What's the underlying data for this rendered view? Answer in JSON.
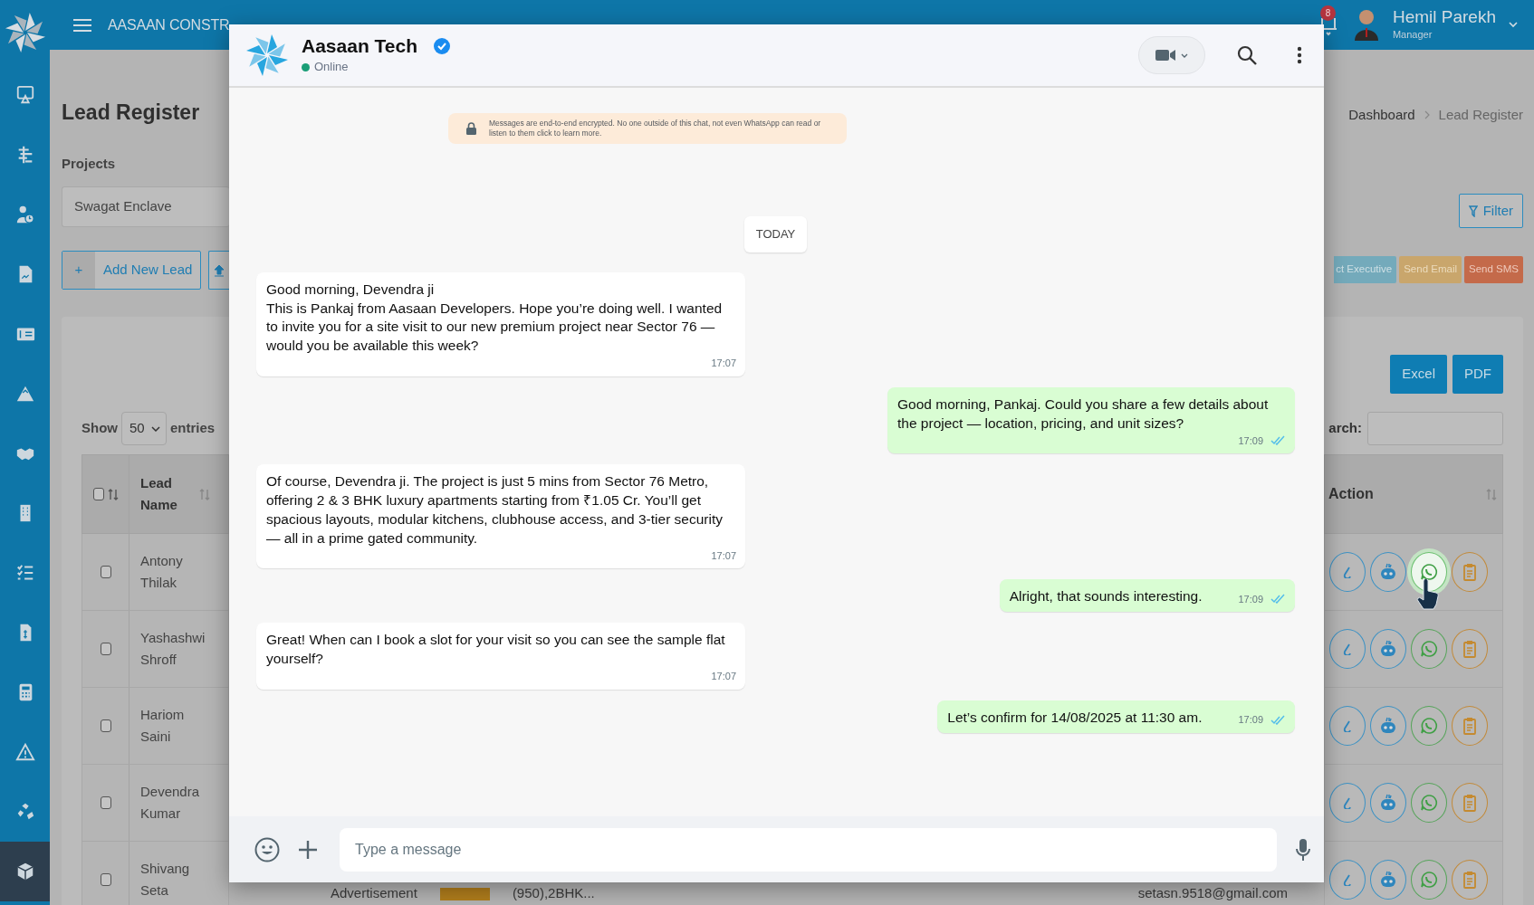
{
  "app_header": {
    "brand": "AASAAN CONSTR",
    "notifications": "8",
    "user_name": "Hemil Parekh",
    "user_role": "Manager"
  },
  "sidebar": {
    "items": [
      {
        "selected": false
      },
      {
        "selected": false
      },
      {
        "selected": false
      },
      {
        "selected": false
      },
      {
        "selected": false
      },
      {
        "selected": false
      },
      {
        "selected": false
      },
      {
        "selected": false
      },
      {
        "selected": false
      },
      {
        "selected": false
      },
      {
        "selected": false
      },
      {
        "selected": false
      },
      {
        "selected": false
      },
      {
        "selected": true
      }
    ]
  },
  "page": {
    "title": "Lead Register",
    "projects_label": "Projects",
    "project": "Swagat Enclave",
    "add_icon": "+",
    "add_button": "Add New Lead",
    "breadcrumb": [
      "Dashboard",
      "Lead Register"
    ],
    "filter_button": "Filter",
    "action_buttons": [
      {
        "label": "ct Executive",
        "kind": "info"
      },
      {
        "label": "Send Email",
        "kind": "warning"
      },
      {
        "label": "Send SMS",
        "kind": "danger"
      }
    ],
    "export_buttons": [
      "Excel",
      "PDF"
    ],
    "show_label": "Show",
    "page_size": "50",
    "entries_label": "entries",
    "search_label": "arch:"
  },
  "table": {
    "select_all": {
      "checked": false
    },
    "columns": [
      {
        "label": "Lead Name"
      },
      {
        "label": "Action"
      }
    ],
    "rows": [
      {
        "checked": false,
        "name": "Antony Thilak",
        "chat_hovered": true
      },
      {
        "checked": false,
        "name": "Yashashwi Shroff",
        "chat_hovered": false
      },
      {
        "checked": false,
        "name": "Hariom Saini",
        "chat_hovered": false
      },
      {
        "checked": false,
        "name": "Devendra Kumar",
        "chat_hovered": false
      },
      {
        "checked": false,
        "name": "Shivang Seta",
        "chat_hovered": false
      }
    ],
    "partial_row": {
      "source": "Advertisement",
      "unit": "(950),2BHK...",
      "email": "setasn.9518@gmail.com"
    }
  },
  "chat": {
    "contact": "Aasaan Tech",
    "verified": true,
    "status": "Online",
    "online": true,
    "notice": "Messages are end-to-end encrypted. No one outside of this chat, not even WhatsApp can read or listen to them click to learn more.",
    "date_chip": "TODAY",
    "messages": [
      {
        "kind": "received",
        "text": "Good morning, Devendra ji\nThis is Pankaj from Aasaan Developers. Hope you’re doing well. I wanted to invite you for a site visit to our new premium project near Sector 76 — would you be available this week?",
        "time": "17:07"
      },
      {
        "kind": "sent",
        "text": "Good morning, Pankaj. Could you share a few details about the project — location, pricing, and unit sizes?",
        "time": "17:09",
        "read": true
      },
      {
        "kind": "received",
        "text": "Of course, Devendra ji. The project is just 5 mins from Sector 76 Metro, offering 2 & 3 BHK luxury apartments starting from ₹1.05 Cr. You’ll get spacious layouts, modular kitchens, clubhouse access, and 3-tier security — all in a prime gated community.",
        "time": "17:07"
      },
      {
        "kind": "sent",
        "text": "Alright, that sounds interesting.",
        "time": "17:09",
        "read": true
      },
      {
        "kind": "received",
        "text": "Great! When can I book a slot for your visit so you can see the sample flat yourself?",
        "time": "17:07"
      },
      {
        "kind": "sent",
        "text": "Let’s confirm for 14/08/2025 at 11:30 am.",
        "time": "17:09",
        "read": true
      }
    ],
    "input": {
      "placeholder": "Type a message"
    }
  }
}
